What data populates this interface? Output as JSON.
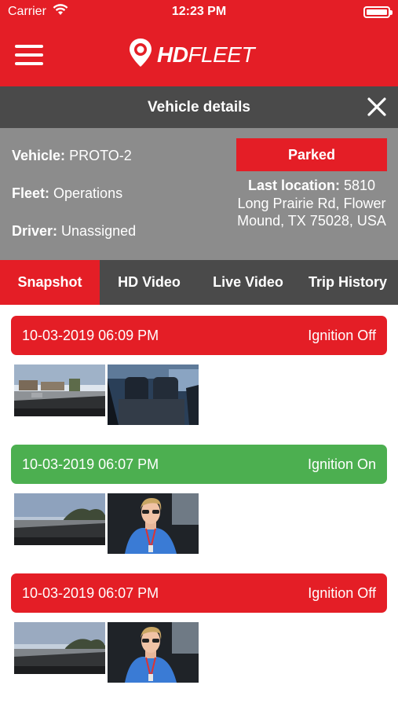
{
  "status_bar": {
    "carrier": "Carrier",
    "time": "12:23 PM",
    "wifi_icon": "wifi-icon",
    "battery_icon": "battery-icon"
  },
  "header": {
    "menu_icon": "hamburger-menu-icon",
    "logo_bold": "HD",
    "logo_thin": "FLEET",
    "logo_icon": "map-pin-icon"
  },
  "details_bar": {
    "title": "Vehicle details",
    "close_icon": "close-icon"
  },
  "vehicle": {
    "vehicle_label": "Vehicle:",
    "vehicle_value": "PROTO-2",
    "fleet_label": "Fleet:",
    "fleet_value": "Operations",
    "driver_label": "Driver:",
    "driver_value": "Unassigned",
    "status": "Parked",
    "last_location_label": "Last location:",
    "last_location_value": "5810 Long Prairie Rd, Flower Mound, TX 75028, USA"
  },
  "tabs": [
    {
      "label": "Snapshot",
      "active": true
    },
    {
      "label": "HD Video",
      "active": false
    },
    {
      "label": "Live Video",
      "active": false
    },
    {
      "label": "Trip History",
      "active": false
    }
  ],
  "events": [
    {
      "datetime": "10-03-2019 06:09 PM",
      "status": "Ignition Off",
      "color": "#e41e26",
      "thumbnails": [
        "road-camera-snapshot",
        "cabin-camera-snapshot-empty-seat"
      ]
    },
    {
      "datetime": "10-03-2019 06:07 PM",
      "status": "Ignition On",
      "color": "#4caf50",
      "thumbnails": [
        "road-camera-snapshot",
        "cabin-camera-snapshot-driver"
      ]
    },
    {
      "datetime": "10-03-2019 06:07 PM",
      "status": "Ignition Off",
      "color": "#e41e26",
      "thumbnails": [
        "road-camera-snapshot",
        "cabin-camera-snapshot-driver"
      ]
    }
  ],
  "colors": {
    "brand_red": "#e41e26",
    "dark_gray": "#4a4a4a",
    "panel_gray": "#8c8c8c",
    "ignition_on_green": "#4caf50"
  }
}
